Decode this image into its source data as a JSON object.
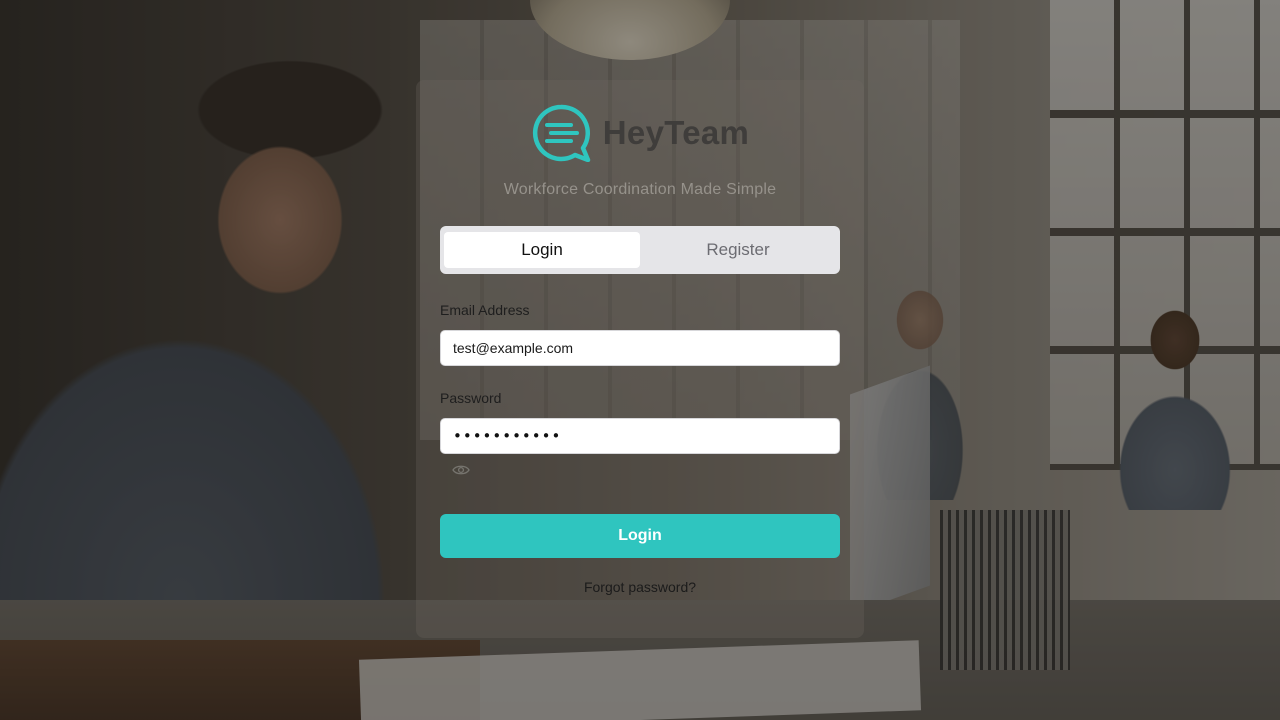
{
  "brand": {
    "name": "HeyTeam",
    "tagline": "Workforce Coordination Made Simple",
    "accent_color": "#2FC5BF",
    "logo_icon": "chat-bubble-icon"
  },
  "tabs": [
    {
      "label": "Login",
      "active": true
    },
    {
      "label": "Register",
      "active": false
    }
  ],
  "form": {
    "email": {
      "label": "Email Address",
      "value": "test@example.com"
    },
    "password": {
      "label": "Password",
      "value_masked": "•••••••••••",
      "toggle_icon": "eye-icon"
    },
    "submit_label": "Login",
    "forgot_label": "Forgot password?"
  }
}
